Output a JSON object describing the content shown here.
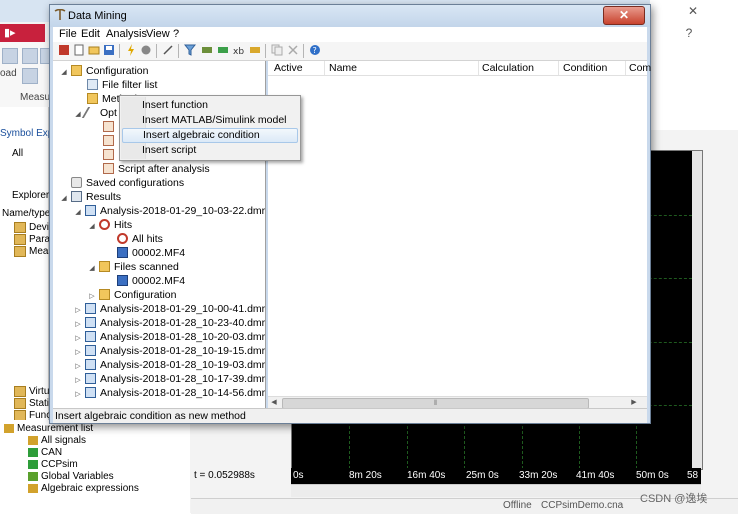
{
  "window": {
    "title": "Data Mining",
    "close_glyph": "✕",
    "menu": [
      "File",
      "Edit",
      "Analysis",
      "View",
      "?"
    ]
  },
  "toolbar_icons": [
    "stop-icon",
    "new-icon",
    "open-icon",
    "save-icon",
    "lightning-icon",
    "record-icon",
    "wand-icon",
    "filter-icon",
    "fx-icon",
    "fx-green-icon",
    "fx-yellow-icon",
    "xb-icon",
    "copy-icon",
    "delete-icon",
    "help-icon"
  ],
  "tree": {
    "configuration": "Configuration",
    "file_filter_list": "File filter list",
    "methods": "Methods",
    "options": "Opt",
    "script_after_analysis": "Script after analysis",
    "saved_configurations": "Saved configurations",
    "results": "Results",
    "analysis_expanded": "Analysis-2018-01-29_10-03-22.dmr",
    "hits": "Hits",
    "all_hits": "All hits",
    "hits_file": "00002.MF4",
    "files_scanned": "Files scanned",
    "files_scanned_file": "00002.MF4",
    "result_configuration": "Configuration",
    "analyses": [
      "Analysis-2018-01-29_10-00-41.dmr",
      "Analysis-2018-01-28_10-23-40.dmr",
      "Analysis-2018-01-28_10-20-03.dmr",
      "Analysis-2018-01-28_10-19-15.dmr",
      "Analysis-2018-01-28_10-19-03.dmr",
      "Analysis-2018-01-28_10-17-39.dmr",
      "Analysis-2018-01-28_10-14-56.dmr"
    ]
  },
  "list": {
    "columns": [
      "Active",
      "Name",
      "Calculation",
      "Condition",
      "Com"
    ]
  },
  "context_menu": {
    "items": [
      "Insert function",
      "Insert MATLAB/Simulink model",
      "Insert algebraic condition",
      "Insert script"
    ],
    "highlighted": "Insert algebraic condition"
  },
  "status": "Insert algebraic condition as new method",
  "background": {
    "app_button": "▮▸",
    "ribbon_labels": [
      "oad",
      "Measur"
    ],
    "symbol_explorer": "Symbol Explo",
    "filter_all": "All",
    "explorer_tab": "Explorer",
    "name_type": "Name/type",
    "tree_left": [
      "Devi",
      "Para",
      "Meas",
      "Virtu",
      "Stati",
      "Func"
    ],
    "measurement_list": {
      "title": "Measurement list",
      "items": [
        "All signals",
        "CAN",
        "CCPsim",
        "Global Variables",
        "Algebraic expressions"
      ]
    },
    "time_readout": "t = 0.052988s",
    "timeline_ticks": [
      "0s",
      "8m 20s",
      "16m 40s",
      "25m 0s",
      "33m 20s",
      "41m 40s",
      "50m 0s",
      "58"
    ],
    "status_items": [
      "Offline",
      "CCPsimDemo.cna"
    ],
    "watermark": "CSDN @逸埃",
    "right_ctrls": [
      "✕",
      "?"
    ]
  }
}
